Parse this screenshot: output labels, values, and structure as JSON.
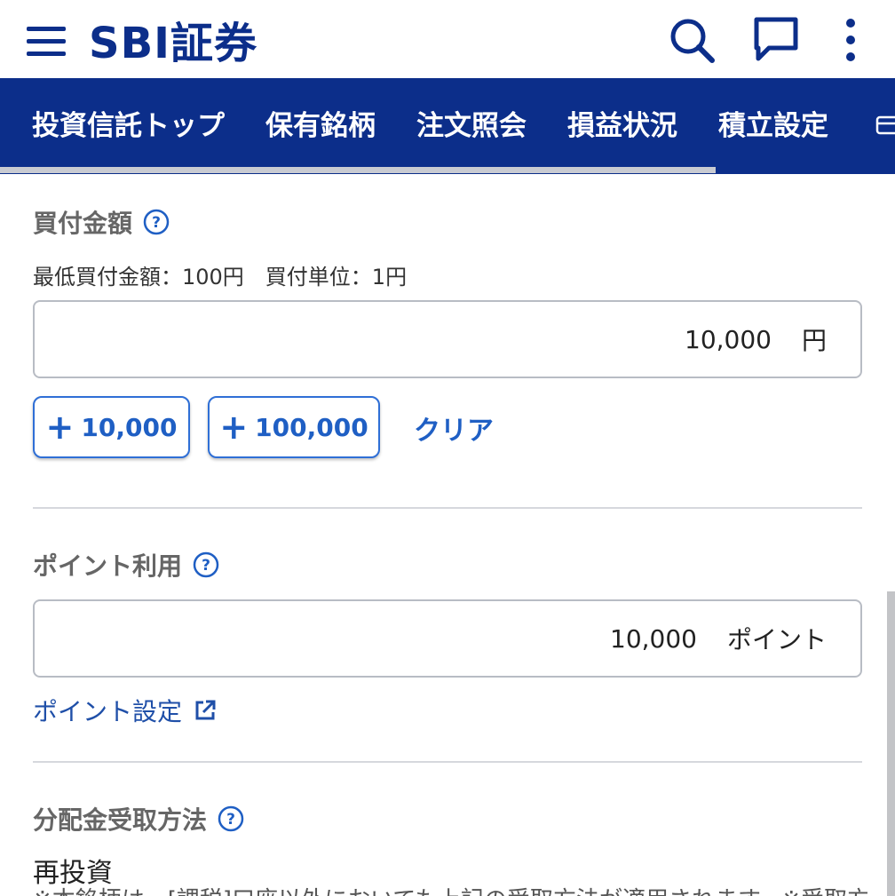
{
  "header": {
    "logo_text": "SBI証券",
    "brand_color": "#0c2e8a"
  },
  "tabs": [
    {
      "label": "投資信託トップ"
    },
    {
      "label": "保有銘柄"
    },
    {
      "label": "注文照会"
    },
    {
      "label": "損益状況"
    },
    {
      "label": "積立設定"
    }
  ],
  "purchase": {
    "title": "買付金額",
    "conditions": "最低買付金額：100円　買付単位：1円",
    "amount_value": "10,000",
    "amount_unit": "円",
    "quick_add": [
      "10,000",
      "100,000"
    ],
    "clear_label": "クリア"
  },
  "points": {
    "title": "ポイント利用",
    "value": "10,000",
    "unit": "ポイント",
    "settings_link": "ポイント設定"
  },
  "distribution": {
    "title": "分配金受取方法",
    "value": "再投資",
    "note_partial": "※本銘柄は、[課税]口座以外においても上記の受取方法が適用されます。※受取方"
  },
  "colors": {
    "accent": "#1f5fc4",
    "link": "#1f4fa8",
    "header_text": "#ffffff"
  }
}
